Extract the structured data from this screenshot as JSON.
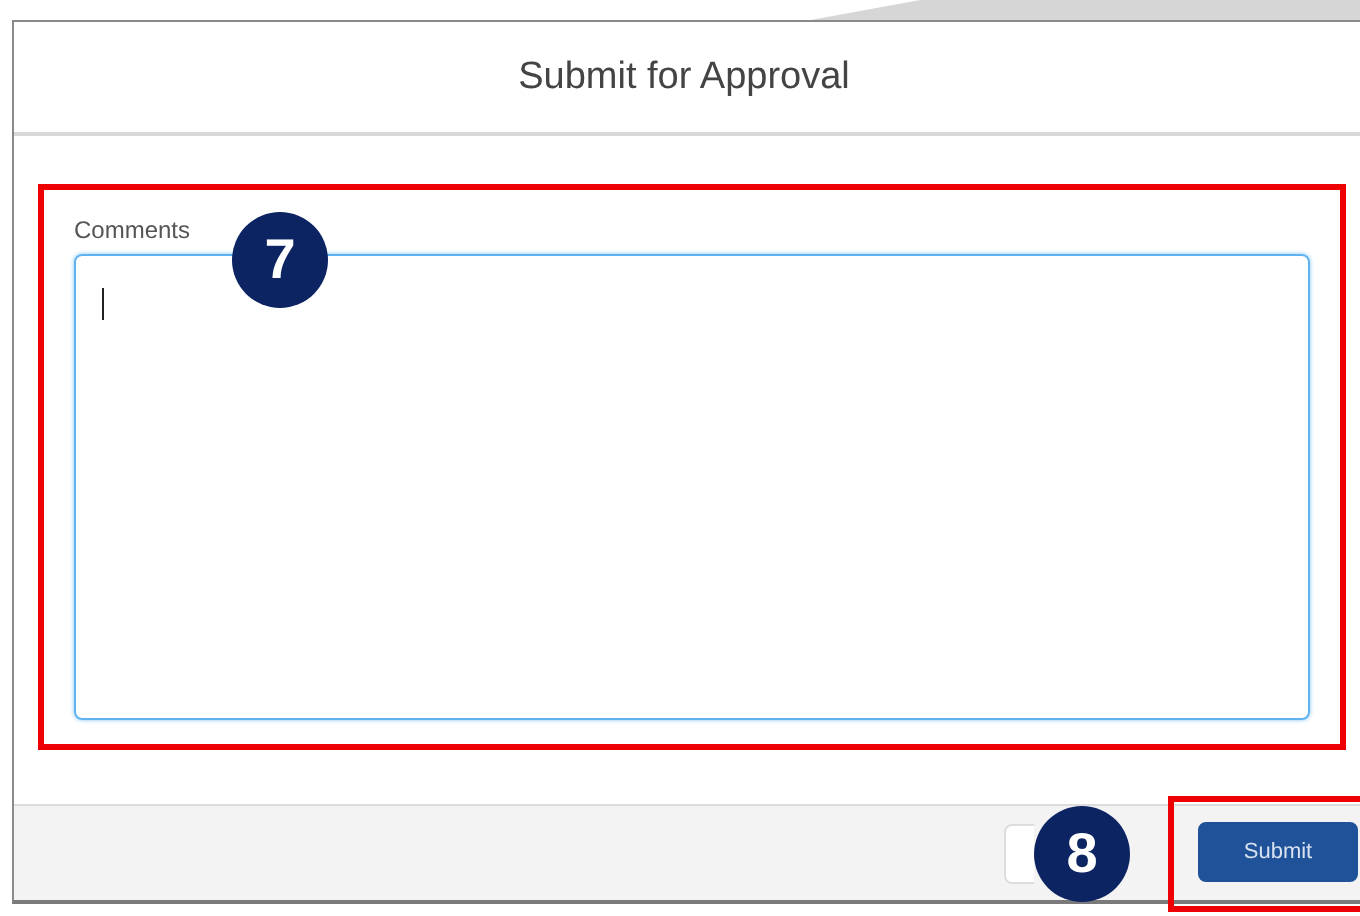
{
  "modal": {
    "title": "Submit for Approval"
  },
  "comments": {
    "label": "Comments",
    "focused": true,
    "highlighted": true,
    "annotation": "7"
  },
  "footer": {
    "buttons": [
      {
        "kind": "secondary",
        "highlighted": false
      },
      {
        "kind": "primary",
        "label": "Submit",
        "highlighted": true
      }
    ],
    "annotation": "8"
  }
}
